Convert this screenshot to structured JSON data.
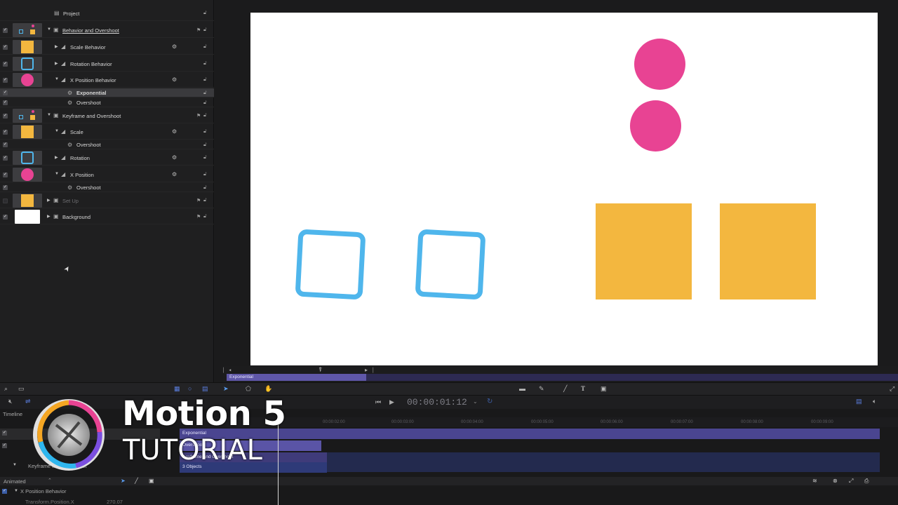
{
  "layers": [
    {
      "name": "Project",
      "indent": 0,
      "thumb": null,
      "check": null,
      "expand": "",
      "icon": "project-icon",
      "gear": false,
      "group": false
    },
    {
      "name": "Behavior and Overshoot",
      "indent": 0,
      "thumb": "group",
      "check": true,
      "expand": "▼",
      "icon": "group-icon",
      "gear": false,
      "group": true
    },
    {
      "name": "Scale Behavior",
      "indent": 1,
      "thumb": "yellow",
      "check": true,
      "expand": "▶",
      "icon": "behavior-icon",
      "gear": true,
      "group": false
    },
    {
      "name": "Rotation Behavior",
      "indent": 1,
      "thumb": "blue",
      "check": true,
      "expand": "▶",
      "icon": "behavior-icon",
      "gear": false,
      "group": false
    },
    {
      "name": "X Position Behavior",
      "indent": 1,
      "thumb": "pink",
      "check": true,
      "expand": "▼",
      "icon": "behavior-icon",
      "gear": true,
      "group": false
    },
    {
      "name": "Exponential",
      "indent": 2,
      "thumb": null,
      "check": true,
      "expand": "",
      "icon": "behavior-small-icon",
      "gear": false,
      "group": false,
      "selected": true
    },
    {
      "name": "Overshoot",
      "indent": 2,
      "thumb": null,
      "check": true,
      "expand": "",
      "icon": "behavior-small-icon",
      "gear": false,
      "group": false
    },
    {
      "name": "Keyframe and Overshoot",
      "indent": 0,
      "thumb": "group",
      "check": true,
      "expand": "▼",
      "icon": "group-icon",
      "gear": false,
      "group": true
    },
    {
      "name": "Scale",
      "indent": 1,
      "thumb": "yellow",
      "check": true,
      "expand": "▼",
      "icon": "behavior-icon",
      "gear": true,
      "group": false
    },
    {
      "name": "Overshoot",
      "indent": 2,
      "thumb": null,
      "check": true,
      "expand": "",
      "icon": "behavior-small-icon",
      "gear": false,
      "group": false
    },
    {
      "name": "Rotation",
      "indent": 1,
      "thumb": "blue",
      "check": true,
      "expand": "▶",
      "icon": "behavior-icon",
      "gear": true,
      "group": false
    },
    {
      "name": "X Position",
      "indent": 1,
      "thumb": "pink",
      "check": true,
      "expand": "▼",
      "icon": "behavior-icon",
      "gear": true,
      "group": false
    },
    {
      "name": "Overshoot",
      "indent": 2,
      "thumb": null,
      "check": true,
      "expand": "",
      "icon": "behavior-small-icon",
      "gear": false,
      "group": false
    },
    {
      "name": "Set Up",
      "indent": 0,
      "thumb": "yellow",
      "check": false,
      "expand": "▶",
      "icon": "group-icon",
      "gear": false,
      "group": true,
      "dim": true
    },
    {
      "name": "Background",
      "indent": 0,
      "thumb": "white",
      "check": true,
      "expand": "▶",
      "icon": "group-icon",
      "gear": false,
      "group": true
    }
  ],
  "mini_timeline": {
    "label": "Exponential"
  },
  "transport": {
    "timecode": "00:00:01:12"
  },
  "timeline": {
    "title": "Timeline",
    "track1": "Exponential",
    "track2": "Overshoot",
    "track3": "Keyframe and Overshoot",
    "track4": "3 Objects",
    "group_label": "Keyframe and Overshoot",
    "animated_label": "Animated",
    "xpos_label": "X Position Behavior",
    "transform_label": "Transform.Position.X",
    "transform_value": "270.07",
    "ruler": [
      "00:00:02:00",
      "00:00:03:00",
      "00:00:04:00",
      "00:00:05:00",
      "00:00:06:00",
      "00:00:07:00",
      "00:00:08:00",
      "00:00:09:00"
    ]
  },
  "brand": {
    "title": "Motion 5",
    "subtitle": "TUTORIAL"
  },
  "colors": {
    "pink": "#e84393",
    "yellow": "#f3b73f",
    "blue": "#4fb6ec",
    "accent": "#5f57a8"
  }
}
